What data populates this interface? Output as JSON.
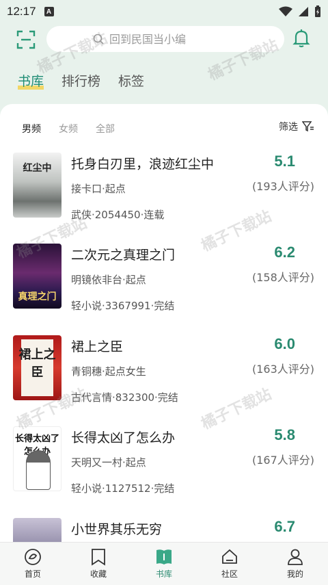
{
  "status_bar": {
    "time": "12:17",
    "note_icon_letter": "A",
    "icons": [
      "wifi-icon",
      "signal-icon",
      "battery-icon"
    ]
  },
  "header": {
    "search_placeholder": "回到民国当小编"
  },
  "top_tabs": [
    {
      "label": "书库",
      "active": true
    },
    {
      "label": "排行榜",
      "active": false
    },
    {
      "label": "标签",
      "active": false
    }
  ],
  "filters": {
    "options": [
      {
        "label": "男频",
        "active": true
      },
      {
        "label": "女频",
        "active": false
      },
      {
        "label": "全部",
        "active": false
      }
    ],
    "screen_label": "筛选"
  },
  "books": [
    {
      "title": "托身白刃里，浪迹红尘中",
      "author": "接卡口·起点",
      "meta": "武侠·2054450·连载",
      "score": "5.1",
      "ratings": "(193人评分)",
      "cover_text": "红尘中"
    },
    {
      "title": "二次元之真理之门",
      "author": "明镜依非台·起点",
      "meta": "轻小说·3367991·完结",
      "score": "6.2",
      "ratings": "(158人评分)",
      "cover_text": "真理之门"
    },
    {
      "title": "裙上之臣",
      "author": "青铜穗·起点女生",
      "meta": "古代言情·832300·完结",
      "score": "6.0",
      "ratings": "(163人评分)",
      "cover_text": "裙上之臣"
    },
    {
      "title": "长得太凶了怎么办",
      "author": "天明又一村·起点",
      "meta": "轻小说·1127512·完结",
      "score": "5.8",
      "ratings": "(167人评分)",
      "cover_text": "长得太凶了怎么办"
    },
    {
      "title": "小世界其乐无穷",
      "author": "",
      "meta": "",
      "score": "6.7",
      "ratings": "",
      "cover_text": ""
    }
  ],
  "bottom_nav": [
    {
      "label": "首页",
      "icon": "home-icon",
      "active": false
    },
    {
      "label": "收藏",
      "icon": "bookmark-icon",
      "active": false
    },
    {
      "label": "书库",
      "icon": "library-icon",
      "active": true
    },
    {
      "label": "社区",
      "icon": "community-icon",
      "active": false
    },
    {
      "label": "我的",
      "icon": "profile-icon",
      "active": false
    }
  ],
  "watermark": "橘子下载站",
  "colors": {
    "accent": "#2a8a70",
    "tab_underline": "#f3d250",
    "background": "#e8f2ec"
  }
}
